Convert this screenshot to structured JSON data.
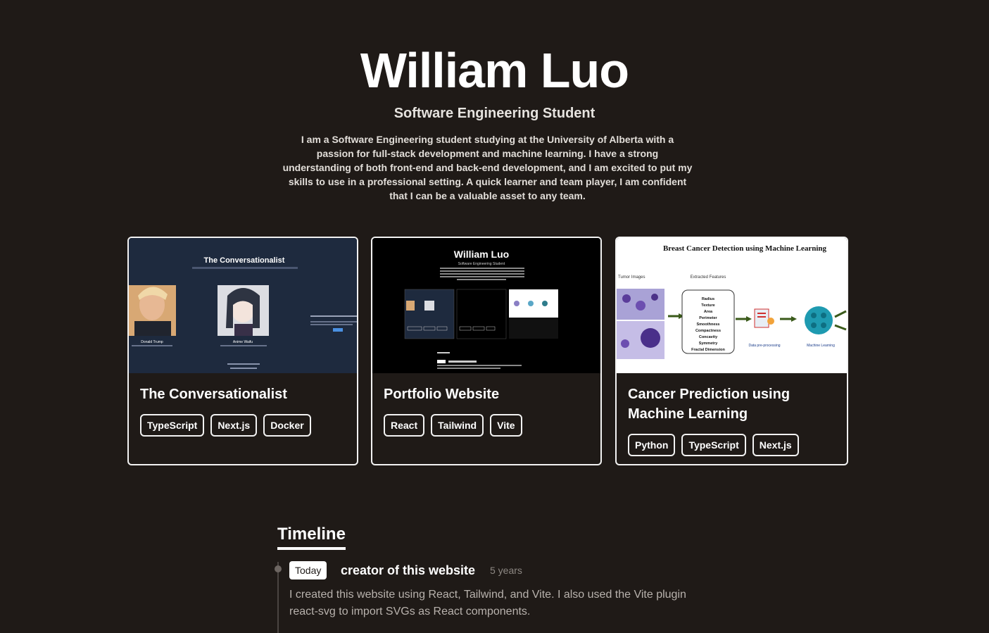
{
  "header": {
    "name": "William Luo",
    "role": "Software Engineering Student",
    "bio": "I am a Software Engineering student studying at the University of Alberta with a passion for full-stack development and machine learning. I have a strong understanding of both front-end and back-end development, and I am excited to put my skills to use in a professional setting. A quick learner and team player, I am confident that I can be a valuable asset to any team."
  },
  "projects": [
    {
      "title": "The Conversationalist",
      "tags": [
        "TypeScript",
        "Next.js",
        "Docker"
      ],
      "thumb": {
        "heading": "The Conversationalist",
        "person1": "Donald Trump",
        "person2": "Anime Waifu"
      }
    },
    {
      "title": "Portfolio Website",
      "tags": [
        "React",
        "Tailwind",
        "Vite"
      ],
      "thumb": {
        "heading": "William Luo",
        "subheading": "Software Engineering Student"
      }
    },
    {
      "title": "Cancer Prediction using Machine Learning",
      "tags": [
        "Python",
        "TypeScript",
        "Next.js"
      ],
      "thumb": {
        "heading": "Breast Cancer Detection using Machine Learning",
        "col1": "Tumor Images",
        "col2": "Extracted Features",
        "features": [
          "Radius",
          "Texture",
          "Area",
          "Perimeter",
          "Smoothness",
          "Compactness",
          "Concavity",
          "Symmetry",
          "Fractal Dimension"
        ],
        "step1": "Data pre-processing",
        "step2": "Machine Learning"
      }
    }
  ],
  "timeline": {
    "heading": "Timeline",
    "entries": [
      {
        "badge": "Today",
        "title": "creator of this website",
        "age": "5 years",
        "description": "I created this website using React, Tailwind, and Vite. I also used the Vite plugin react-svg to import SVGs as React components."
      }
    ]
  },
  "colors": {
    "background": "#1f1a17",
    "text": "#ffffff",
    "muted": "#b8b2ad",
    "border": "#f2f2f2"
  }
}
